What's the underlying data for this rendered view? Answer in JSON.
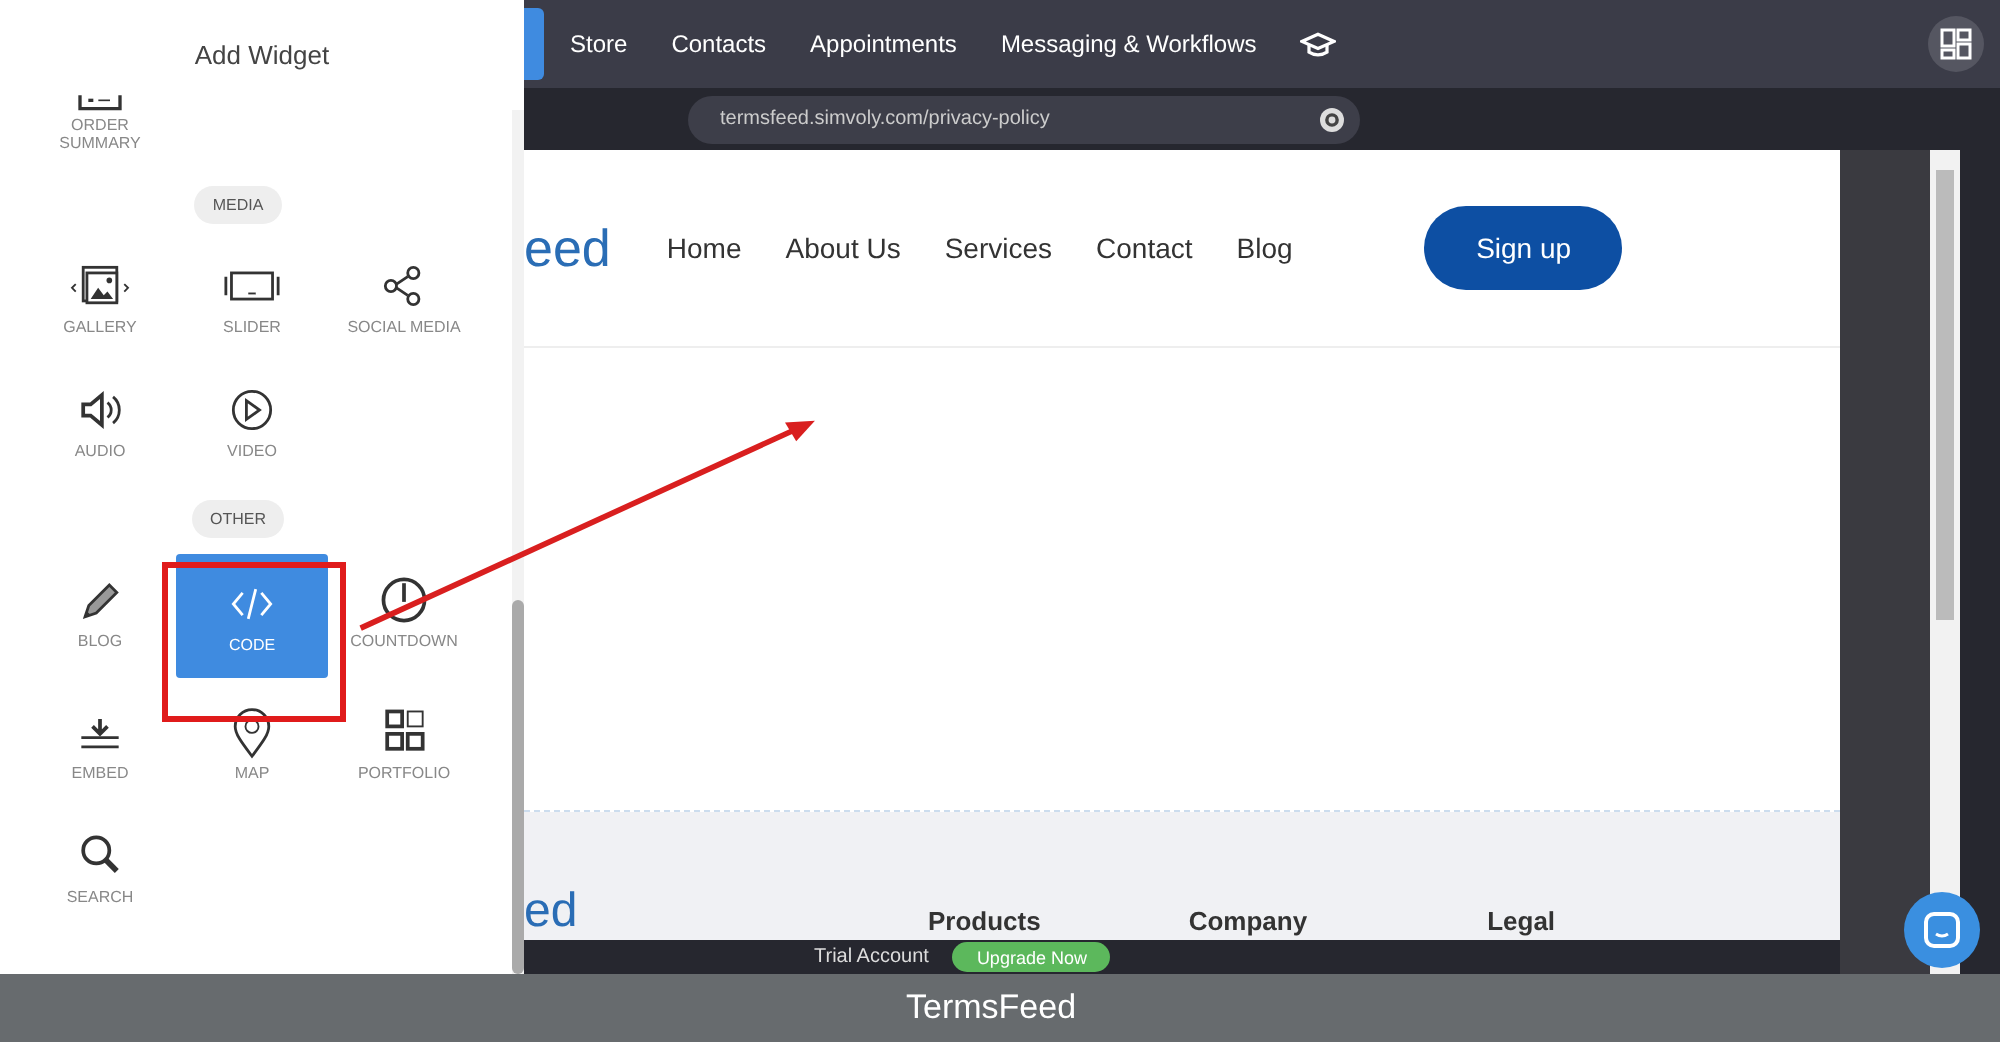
{
  "panel": {
    "title": "Add Widget",
    "sections": [
      {
        "items": [
          {
            "kind": "order-summary",
            "label": "ORDER\nSUMMARY",
            "selected": false
          }
        ]
      },
      {
        "label": "MEDIA",
        "items": [
          {
            "kind": "gallery",
            "label": "GALLERY",
            "selected": false
          },
          {
            "kind": "slider",
            "label": "SLIDER",
            "selected": false
          },
          {
            "kind": "social",
            "label": "SOCIAL MEDIA",
            "selected": false
          },
          {
            "kind": "audio",
            "label": "AUDIO",
            "selected": false
          },
          {
            "kind": "video",
            "label": "VIDEO",
            "selected": false
          }
        ]
      },
      {
        "label": "OTHER",
        "items": [
          {
            "kind": "blog",
            "label": "BLOG",
            "selected": false
          },
          {
            "kind": "code",
            "label": "CODE",
            "selected": true
          },
          {
            "kind": "countdown",
            "label": "COUNTDOWN",
            "selected": false
          },
          {
            "kind": "embed",
            "label": "EMBED",
            "selected": false
          },
          {
            "kind": "map",
            "label": "MAP",
            "selected": false
          },
          {
            "kind": "portfolio",
            "label": "PORTFOLIO",
            "selected": false
          },
          {
            "kind": "search",
            "label": "SEARCH",
            "selected": false
          }
        ]
      }
    ]
  },
  "top_nav": [
    "Store",
    "Contacts",
    "Appointments",
    "Messaging & Workflows"
  ],
  "url": "termsfeed.simvoly.com/privacy-policy",
  "site": {
    "logo": "eed",
    "nav": [
      "Home",
      "About Us",
      "Services",
      "Contact",
      "Blog"
    ],
    "signup": "Sign up",
    "footer_logo": "ed",
    "footer_headings": [
      "Products",
      "Company",
      "Legal"
    ]
  },
  "trial": {
    "label": "Trial Account",
    "button": "Upgrade Now"
  },
  "caption": "TermsFeed"
}
